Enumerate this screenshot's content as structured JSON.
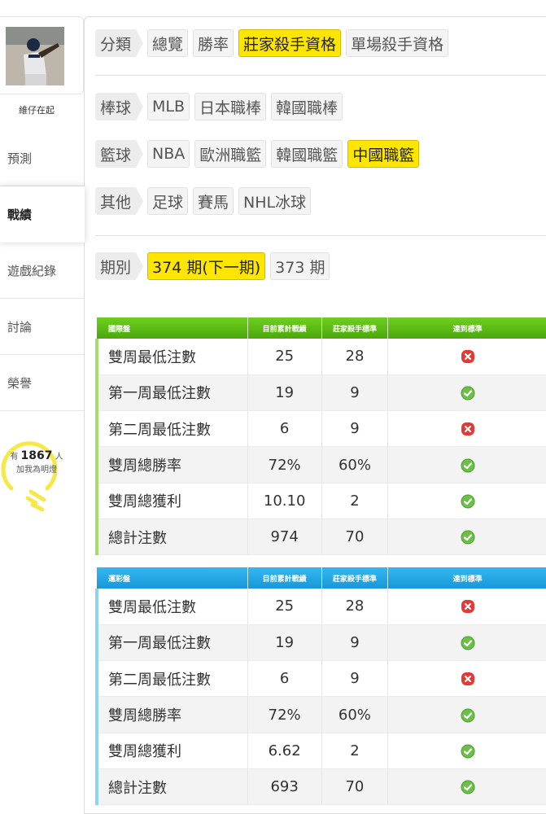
{
  "sidebar": {
    "username": "維仔在起",
    "nav": [
      "預測",
      "戰績",
      "遊戲紀錄",
      "討論",
      "榮譽"
    ],
    "active_index": 1,
    "fans": {
      "prefix": "有",
      "count": "1867",
      "suffix": "人",
      "line2": "加我為明燈"
    }
  },
  "filters": {
    "category": {
      "label": "分類",
      "options": [
        "總覽",
        "勝率",
        "莊家殺手資格",
        "單場殺手資格"
      ],
      "selected": 2
    },
    "baseball": {
      "label": "棒球",
      "options": [
        "MLB",
        "日本職棒",
        "韓國職棒"
      ],
      "selected": -1
    },
    "basketball": {
      "label": "籃球",
      "options": [
        "NBA",
        "歐洲職籃",
        "韓國職籃",
        "中國職籃"
      ],
      "selected": 3
    },
    "other": {
      "label": "其他",
      "options": [
        "足球",
        "賽馬",
        "NHL冰球"
      ],
      "selected": -1
    },
    "period": {
      "label": "期別",
      "options": [
        "374 期(下一期)",
        "373 期"
      ],
      "selected": 0
    }
  },
  "tables": [
    {
      "title": "國際盤",
      "headers": [
        "目前累計戰績",
        "莊家殺手標準",
        "達到標準"
      ],
      "rows": [
        {
          "label": "雙周最低注數",
          "current": "25",
          "standard": "28",
          "met": false
        },
        {
          "label": "第一周最低注數",
          "current": "19",
          "standard": "9",
          "met": true
        },
        {
          "label": "第二周最低注數",
          "current": "6",
          "standard": "9",
          "met": false
        },
        {
          "label": "雙周總勝率",
          "current": "72%",
          "standard": "60%",
          "met": true
        },
        {
          "label": "雙周總獲利",
          "current": "10.10",
          "standard": "2",
          "met": true
        },
        {
          "label": "總計注數",
          "current": "974",
          "standard": "70",
          "met": true
        }
      ]
    },
    {
      "title": "運彩盤",
      "headers": [
        "目前累計戰績",
        "莊家殺手標準",
        "達到標準"
      ],
      "rows": [
        {
          "label": "雙周最低注數",
          "current": "25",
          "standard": "28",
          "met": false
        },
        {
          "label": "第一周最低注數",
          "current": "19",
          "standard": "9",
          "met": true
        },
        {
          "label": "第二周最低注數",
          "current": "6",
          "standard": "9",
          "met": false
        },
        {
          "label": "雙周總勝率",
          "current": "72%",
          "standard": "60%",
          "met": true
        },
        {
          "label": "雙周總獲利",
          "current": "6.62",
          "standard": "2",
          "met": true
        },
        {
          "label": "總計注數",
          "current": "693",
          "standard": "70",
          "met": true
        }
      ]
    }
  ],
  "colors": {
    "highlight": "#ffe600",
    "green_header": "#5cbc16",
    "blue_header": "#1fa6e2",
    "fail_red": "#e53935",
    "pass_green": "#6cc04a",
    "bulb_yellow": "#f5e84a"
  },
  "icons": {
    "fail": "x-circle-icon",
    "pass": "check-circle-icon",
    "fans": "lightbulb-icon"
  }
}
